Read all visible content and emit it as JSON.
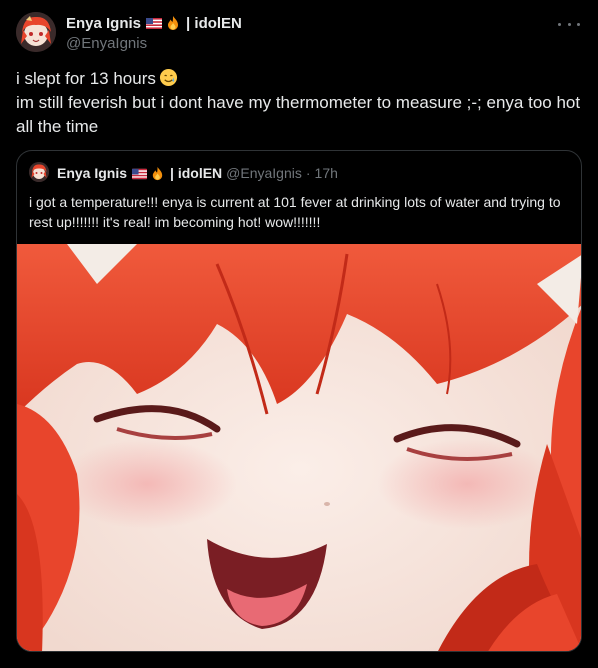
{
  "tweet": {
    "display_name": "Enya Ignis",
    "name_suffix": "| idolEN",
    "handle": "@EnyaIgnis",
    "badges": [
      "usa-flag-emoji",
      "fire-emoji"
    ],
    "more_icon": "more-horizontal-icon",
    "text_lines": [
      "i slept for 13 hours",
      "im still feverish but i dont have my thermometer to measure ;-; enya too hot all the time"
    ],
    "inline_emoji": "smiling-face-with-tear-emoji"
  },
  "quote": {
    "display_name": "Enya Ignis",
    "name_suffix": "| idolEN",
    "handle": "@EnyaIgnis",
    "separator": "·",
    "time": "17h",
    "text": "i got a temperature!!! enya is current at 101 fever at drinking lots of water and trying to rest up!!!!!!! it's real! im becoming hot! wow!!!!!!!",
    "media": "anime-girl-closeup-image"
  },
  "colors": {
    "background": "#000000",
    "primary_text": "#e7e9ea",
    "secondary_text": "#71767b",
    "border": "#2f3336",
    "hair": "#e8452c",
    "skin": "#f6e6de"
  }
}
